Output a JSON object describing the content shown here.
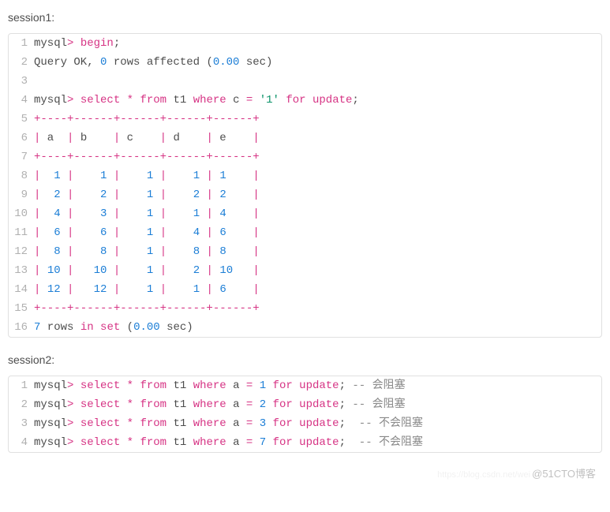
{
  "labels": {
    "session1": "session1:",
    "session2": "session2:"
  },
  "session1": {
    "lines": [
      [
        [
          "op",
          "mysql"
        ],
        [
          "kw",
          "> "
        ],
        [
          "kw",
          "begin"
        ],
        [
          "op",
          ";"
        ]
      ],
      [
        [
          "op",
          "Query OK, "
        ],
        [
          "num",
          "0"
        ],
        [
          "op",
          " rows affected ("
        ],
        [
          "num",
          "0.00"
        ],
        [
          "op",
          " sec)"
        ]
      ],
      [
        [
          "op",
          ""
        ]
      ],
      [
        [
          "op",
          "mysql"
        ],
        [
          "kw",
          "> "
        ],
        [
          "kw",
          "select"
        ],
        [
          "op",
          " "
        ],
        [
          "kw",
          "*"
        ],
        [
          "op",
          " "
        ],
        [
          "kw",
          "from"
        ],
        [
          "op",
          " t1 "
        ],
        [
          "kw",
          "where"
        ],
        [
          "op",
          " c "
        ],
        [
          "kw",
          "="
        ],
        [
          "op",
          " "
        ],
        [
          "str",
          "'1'"
        ],
        [
          "op",
          " "
        ],
        [
          "kw",
          "for"
        ],
        [
          "op",
          " "
        ],
        [
          "kw",
          "update"
        ],
        [
          "op",
          ";"
        ]
      ],
      [
        [
          "kw",
          "+----+------+------+------+------+"
        ]
      ],
      [
        [
          "kw",
          "|"
        ],
        [
          "op",
          " a  "
        ],
        [
          "kw",
          "|"
        ],
        [
          "op",
          " b    "
        ],
        [
          "kw",
          "|"
        ],
        [
          "op",
          " c    "
        ],
        [
          "kw",
          "|"
        ],
        [
          "op",
          " d    "
        ],
        [
          "kw",
          "|"
        ],
        [
          "op",
          " e    "
        ],
        [
          "kw",
          "|"
        ]
      ],
      [
        [
          "kw",
          "+----+------+------+------+------+"
        ]
      ],
      [
        [
          "kw",
          "|"
        ],
        [
          "op",
          "  "
        ],
        [
          "num",
          "1"
        ],
        [
          "op",
          " "
        ],
        [
          "kw",
          "|"
        ],
        [
          "op",
          "    "
        ],
        [
          "num",
          "1"
        ],
        [
          "op",
          " "
        ],
        [
          "kw",
          "|"
        ],
        [
          "op",
          "    "
        ],
        [
          "num",
          "1"
        ],
        [
          "op",
          " "
        ],
        [
          "kw",
          "|"
        ],
        [
          "op",
          "    "
        ],
        [
          "num",
          "1"
        ],
        [
          "op",
          " "
        ],
        [
          "kw",
          "|"
        ],
        [
          "op",
          " "
        ],
        [
          "num",
          "1"
        ],
        [
          "op",
          "    "
        ],
        [
          "kw",
          "|"
        ]
      ],
      [
        [
          "kw",
          "|"
        ],
        [
          "op",
          "  "
        ],
        [
          "num",
          "2"
        ],
        [
          "op",
          " "
        ],
        [
          "kw",
          "|"
        ],
        [
          "op",
          "    "
        ],
        [
          "num",
          "2"
        ],
        [
          "op",
          " "
        ],
        [
          "kw",
          "|"
        ],
        [
          "op",
          "    "
        ],
        [
          "num",
          "1"
        ],
        [
          "op",
          " "
        ],
        [
          "kw",
          "|"
        ],
        [
          "op",
          "    "
        ],
        [
          "num",
          "2"
        ],
        [
          "op",
          " "
        ],
        [
          "kw",
          "|"
        ],
        [
          "op",
          " "
        ],
        [
          "num",
          "2"
        ],
        [
          "op",
          "    "
        ],
        [
          "kw",
          "|"
        ]
      ],
      [
        [
          "kw",
          "|"
        ],
        [
          "op",
          "  "
        ],
        [
          "num",
          "4"
        ],
        [
          "op",
          " "
        ],
        [
          "kw",
          "|"
        ],
        [
          "op",
          "    "
        ],
        [
          "num",
          "3"
        ],
        [
          "op",
          " "
        ],
        [
          "kw",
          "|"
        ],
        [
          "op",
          "    "
        ],
        [
          "num",
          "1"
        ],
        [
          "op",
          " "
        ],
        [
          "kw",
          "|"
        ],
        [
          "op",
          "    "
        ],
        [
          "num",
          "1"
        ],
        [
          "op",
          " "
        ],
        [
          "kw",
          "|"
        ],
        [
          "op",
          " "
        ],
        [
          "num",
          "4"
        ],
        [
          "op",
          "    "
        ],
        [
          "kw",
          "|"
        ]
      ],
      [
        [
          "kw",
          "|"
        ],
        [
          "op",
          "  "
        ],
        [
          "num",
          "6"
        ],
        [
          "op",
          " "
        ],
        [
          "kw",
          "|"
        ],
        [
          "op",
          "    "
        ],
        [
          "num",
          "6"
        ],
        [
          "op",
          " "
        ],
        [
          "kw",
          "|"
        ],
        [
          "op",
          "    "
        ],
        [
          "num",
          "1"
        ],
        [
          "op",
          " "
        ],
        [
          "kw",
          "|"
        ],
        [
          "op",
          "    "
        ],
        [
          "num",
          "4"
        ],
        [
          "op",
          " "
        ],
        [
          "kw",
          "|"
        ],
        [
          "op",
          " "
        ],
        [
          "num",
          "6"
        ],
        [
          "op",
          "    "
        ],
        [
          "kw",
          "|"
        ]
      ],
      [
        [
          "kw",
          "|"
        ],
        [
          "op",
          "  "
        ],
        [
          "num",
          "8"
        ],
        [
          "op",
          " "
        ],
        [
          "kw",
          "|"
        ],
        [
          "op",
          "    "
        ],
        [
          "num",
          "8"
        ],
        [
          "op",
          " "
        ],
        [
          "kw",
          "|"
        ],
        [
          "op",
          "    "
        ],
        [
          "num",
          "1"
        ],
        [
          "op",
          " "
        ],
        [
          "kw",
          "|"
        ],
        [
          "op",
          "    "
        ],
        [
          "num",
          "8"
        ],
        [
          "op",
          " "
        ],
        [
          "kw",
          "|"
        ],
        [
          "op",
          " "
        ],
        [
          "num",
          "8"
        ],
        [
          "op",
          "    "
        ],
        [
          "kw",
          "|"
        ]
      ],
      [
        [
          "kw",
          "|"
        ],
        [
          "op",
          " "
        ],
        [
          "num",
          "10"
        ],
        [
          "op",
          " "
        ],
        [
          "kw",
          "|"
        ],
        [
          "op",
          "   "
        ],
        [
          "num",
          "10"
        ],
        [
          "op",
          " "
        ],
        [
          "kw",
          "|"
        ],
        [
          "op",
          "    "
        ],
        [
          "num",
          "1"
        ],
        [
          "op",
          " "
        ],
        [
          "kw",
          "|"
        ],
        [
          "op",
          "    "
        ],
        [
          "num",
          "2"
        ],
        [
          "op",
          " "
        ],
        [
          "kw",
          "|"
        ],
        [
          "op",
          " "
        ],
        [
          "num",
          "10"
        ],
        [
          "op",
          "   "
        ],
        [
          "kw",
          "|"
        ]
      ],
      [
        [
          "kw",
          "|"
        ],
        [
          "op",
          " "
        ],
        [
          "num",
          "12"
        ],
        [
          "op",
          " "
        ],
        [
          "kw",
          "|"
        ],
        [
          "op",
          "   "
        ],
        [
          "num",
          "12"
        ],
        [
          "op",
          " "
        ],
        [
          "kw",
          "|"
        ],
        [
          "op",
          "    "
        ],
        [
          "num",
          "1"
        ],
        [
          "op",
          " "
        ],
        [
          "kw",
          "|"
        ],
        [
          "op",
          "    "
        ],
        [
          "num",
          "1"
        ],
        [
          "op",
          " "
        ],
        [
          "kw",
          "|"
        ],
        [
          "op",
          " "
        ],
        [
          "num",
          "6"
        ],
        [
          "op",
          "    "
        ],
        [
          "kw",
          "|"
        ]
      ],
      [
        [
          "kw",
          "+----+------+------+------+------+"
        ]
      ],
      [
        [
          "num",
          "7"
        ],
        [
          "op",
          " rows "
        ],
        [
          "kw",
          "in"
        ],
        [
          "op",
          " "
        ],
        [
          "kw",
          "set"
        ],
        [
          "op",
          " ("
        ],
        [
          "num",
          "0.00"
        ],
        [
          "op",
          " sec)"
        ]
      ]
    ]
  },
  "session2": {
    "lines": [
      [
        [
          "op",
          "mysql"
        ],
        [
          "kw",
          "> "
        ],
        [
          "kw",
          "select"
        ],
        [
          "op",
          " "
        ],
        [
          "kw",
          "*"
        ],
        [
          "op",
          " "
        ],
        [
          "kw",
          "from"
        ],
        [
          "op",
          " t1 "
        ],
        [
          "kw",
          "where"
        ],
        [
          "op",
          " a "
        ],
        [
          "kw",
          "="
        ],
        [
          "op",
          " "
        ],
        [
          "num",
          "1"
        ],
        [
          "op",
          " "
        ],
        [
          "kw",
          "for"
        ],
        [
          "op",
          " "
        ],
        [
          "kw",
          "update"
        ],
        [
          "op",
          ";"
        ],
        [
          "cmt",
          " -- 会阻塞"
        ]
      ],
      [
        [
          "op",
          "mysql"
        ],
        [
          "kw",
          "> "
        ],
        [
          "kw",
          "select"
        ],
        [
          "op",
          " "
        ],
        [
          "kw",
          "*"
        ],
        [
          "op",
          " "
        ],
        [
          "kw",
          "from"
        ],
        [
          "op",
          " t1 "
        ],
        [
          "kw",
          "where"
        ],
        [
          "op",
          " a "
        ],
        [
          "kw",
          "="
        ],
        [
          "op",
          " "
        ],
        [
          "num",
          "2"
        ],
        [
          "op",
          " "
        ],
        [
          "kw",
          "for"
        ],
        [
          "op",
          " "
        ],
        [
          "kw",
          "update"
        ],
        [
          "op",
          ";"
        ],
        [
          "cmt",
          " -- 会阻塞"
        ]
      ],
      [
        [
          "op",
          "mysql"
        ],
        [
          "kw",
          "> "
        ],
        [
          "kw",
          "select"
        ],
        [
          "op",
          " "
        ],
        [
          "kw",
          "*"
        ],
        [
          "op",
          " "
        ],
        [
          "kw",
          "from"
        ],
        [
          "op",
          " t1 "
        ],
        [
          "kw",
          "where"
        ],
        [
          "op",
          " a "
        ],
        [
          "kw",
          "="
        ],
        [
          "op",
          " "
        ],
        [
          "num",
          "3"
        ],
        [
          "op",
          " "
        ],
        [
          "kw",
          "for"
        ],
        [
          "op",
          " "
        ],
        [
          "kw",
          "update"
        ],
        [
          "op",
          ";"
        ],
        [
          "cmt",
          "  -- 不会阻塞"
        ]
      ],
      [
        [
          "op",
          "mysql"
        ],
        [
          "kw",
          "> "
        ],
        [
          "kw",
          "select"
        ],
        [
          "op",
          " "
        ],
        [
          "kw",
          "*"
        ],
        [
          "op",
          " "
        ],
        [
          "kw",
          "from"
        ],
        [
          "op",
          " t1 "
        ],
        [
          "kw",
          "where"
        ],
        [
          "op",
          " a "
        ],
        [
          "kw",
          "="
        ],
        [
          "op",
          " "
        ],
        [
          "num",
          "7"
        ],
        [
          "op",
          " "
        ],
        [
          "kw",
          "for"
        ],
        [
          "op",
          " "
        ],
        [
          "kw",
          "update"
        ],
        [
          "op",
          ";"
        ],
        [
          "cmt",
          "  -- 不会阻塞"
        ]
      ]
    ]
  },
  "watermark": {
    "faint": "https://blog.csdn.net/wei",
    "main": "@51CTO博客"
  },
  "chart_data": {
    "type": "table",
    "title": "select * from t1 where c = '1' for update",
    "columns": [
      "a",
      "b",
      "c",
      "d",
      "e"
    ],
    "rows": [
      [
        1,
        1,
        1,
        1,
        1
      ],
      [
        2,
        2,
        1,
        2,
        2
      ],
      [
        4,
        3,
        1,
        1,
        4
      ],
      [
        6,
        6,
        1,
        4,
        6
      ],
      [
        8,
        8,
        1,
        8,
        8
      ],
      [
        10,
        10,
        1,
        2,
        10
      ],
      [
        12,
        12,
        1,
        1,
        6
      ]
    ],
    "row_count": 7,
    "elapsed_sec": 0.0,
    "session2_tests": [
      {
        "sql": "select * from t1 where a = 1 for update",
        "result": "会阻塞"
      },
      {
        "sql": "select * from t1 where a = 2 for update",
        "result": "会阻塞"
      },
      {
        "sql": "select * from t1 where a = 3 for update",
        "result": "不会阻塞"
      },
      {
        "sql": "select * from t1 where a = 7 for update",
        "result": "不会阻塞"
      }
    ]
  }
}
